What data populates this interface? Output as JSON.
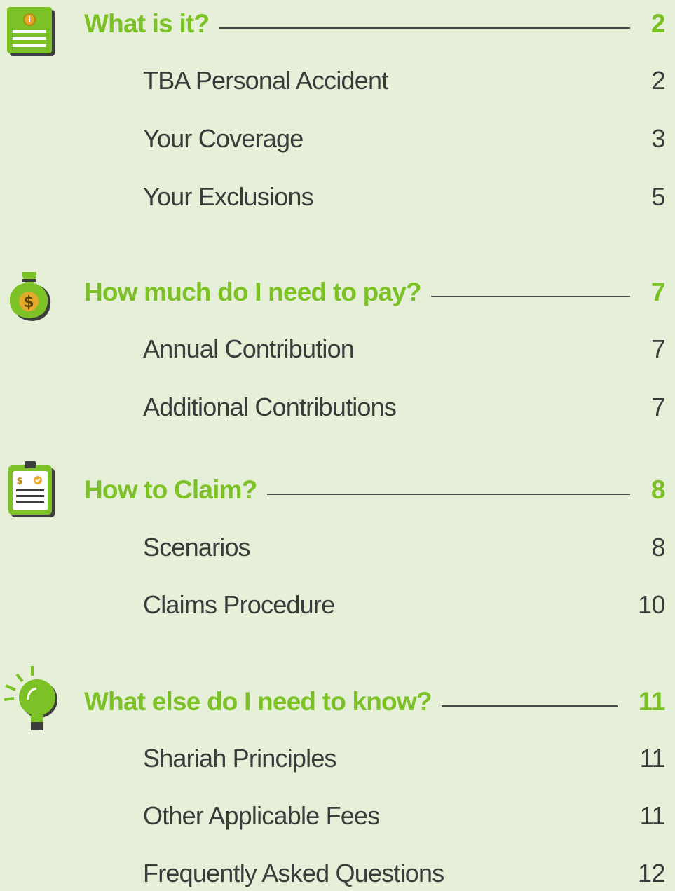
{
  "sections": [
    {
      "title": "What is it?",
      "page": "2",
      "icon": "info-document-icon",
      "items": [
        {
          "label": "TBA Personal Accident",
          "page": "2"
        },
        {
          "label": "Your Coverage",
          "page": "3"
        },
        {
          "label": "Your Exclusions",
          "page": "5"
        }
      ]
    },
    {
      "title": "How much do I need to pay?",
      "page": "7",
      "icon": "money-bag-icon",
      "items": [
        {
          "label": "Annual Contribution",
          "page": "7"
        },
        {
          "label": "Additional Contributions",
          "page": "7"
        }
      ]
    },
    {
      "title": "How to Claim?",
      "page": "8",
      "icon": "claim-clipboard-icon",
      "items": [
        {
          "label": "Scenarios",
          "page": "8"
        },
        {
          "label": "Claims Procedure",
          "page": "10"
        }
      ]
    },
    {
      "title": "What else do I need to know?",
      "page": "11",
      "icon": "lightbulb-icon",
      "items": [
        {
          "label": "Shariah Principles",
          "page": "11"
        },
        {
          "label": "Other Applicable Fees",
          "page": "11"
        },
        {
          "label": "Frequently Asked Questions",
          "page": "12"
        }
      ]
    }
  ],
  "colors": {
    "background": "#e6efd8",
    "accent": "#7cc125",
    "text": "#3b3b3b"
  }
}
